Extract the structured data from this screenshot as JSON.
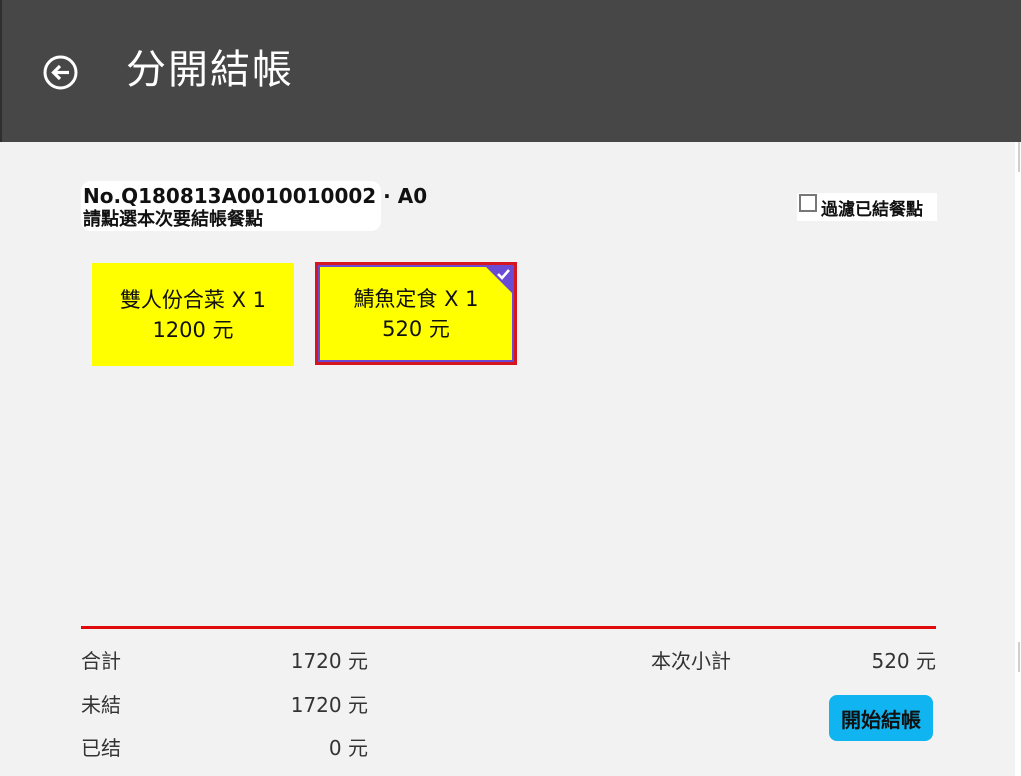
{
  "header": {
    "title": "分開結帳",
    "back_icon": "arrow-left-circle-icon"
  },
  "order": {
    "number": "No.Q180813A0010010002 · A0",
    "hint": "請點選本次要結帳餐點"
  },
  "filter": {
    "label": "過濾已結餐點",
    "checked": false
  },
  "items": [
    {
      "name": "雙人份合菜 X 1",
      "price": "1200 元",
      "selected": false
    },
    {
      "name": "鯖魚定食 X 1",
      "price": "520 元",
      "selected": true
    }
  ],
  "summary": {
    "total_label": "合計",
    "total_value": "1720 元",
    "unpaid_label": "未結",
    "unpaid_value": "1720 元",
    "paid_label": "已结",
    "paid_value": "0 元",
    "subtotal_label": "本次小計",
    "subtotal_value": "520 元"
  },
  "actions": {
    "start_checkout_label": "開始結帳"
  },
  "colors": {
    "header_bg": "#474747",
    "item_bg": "#ffff00",
    "selected_border": "#d6161f",
    "selected_accent": "#6b4bd3",
    "divider": "#e10a0a",
    "button_bg": "#10b4f0"
  }
}
